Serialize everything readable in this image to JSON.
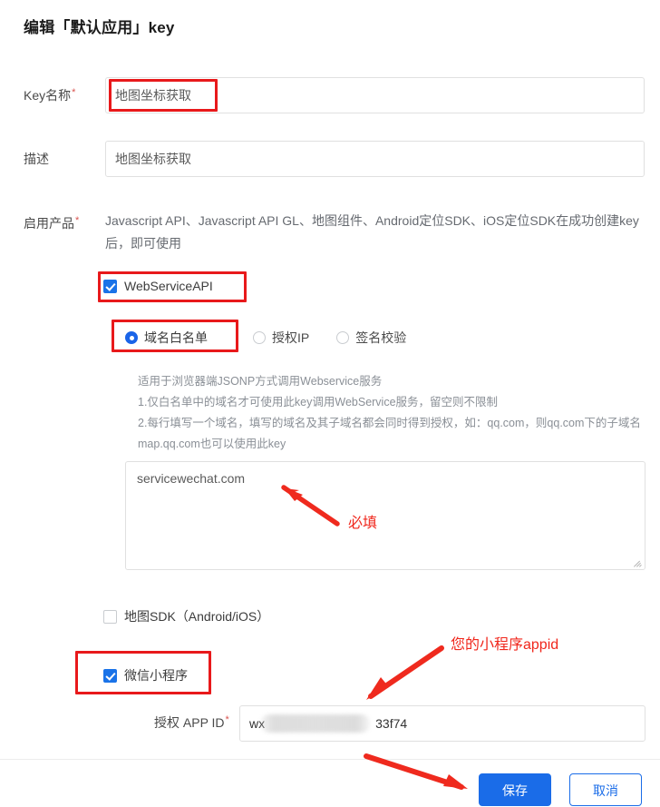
{
  "page": {
    "title": "编辑「默认应用」key"
  },
  "fields": {
    "key_name": {
      "label": "Key名称",
      "required_mark": "*",
      "value": "地图坐标获取"
    },
    "description": {
      "label": "描述",
      "value": "地图坐标获取"
    },
    "enabled_products": {
      "label": "启用产品",
      "required_mark": "*",
      "hint": "Javascript API、Javascript API GL、地图组件、Android定位SDK、iOS定位SDK在成功创建key后，即可使用"
    },
    "app_id": {
      "label": "授权 APP ID",
      "required_mark": "*",
      "value_prefix": "wx",
      "value_suffix": "33f74"
    }
  },
  "products": {
    "webservice_api": {
      "label": "WebServiceAPI",
      "checked": true
    },
    "map_sdk": {
      "label": "地图SDK（Android/iOS）",
      "checked": false
    },
    "wechat_miniprogram": {
      "label": "微信小程序",
      "checked": true
    }
  },
  "auth_modes": {
    "selected": "域名白名单",
    "options": [
      {
        "label": "域名白名单",
        "selected": true
      },
      {
        "label": "授权IP",
        "selected": false
      },
      {
        "label": "签名校验",
        "selected": false
      }
    ]
  },
  "whitelist_help": {
    "line1": "适用于浏览器端JSONP方式调用Webservice服务",
    "line2": "1.仅白名单中的域名才可使用此key调用WebService服务，留空则不限制",
    "line3": "2.每行填写一个域名，填写的域名及其子域名都会同时得到授权，如：qq.com，则qq.com下的子域名map.qq.com也可以使用此key"
  },
  "domain_textarea": {
    "value": "servicewechat.com",
    "placeholder": ""
  },
  "annotations": {
    "required_note": "必填",
    "appid_note": "您的小程序appid",
    "color": "#f0271c",
    "box_color": "#e8191b"
  },
  "buttons": {
    "save": "保存",
    "cancel": "取消"
  }
}
